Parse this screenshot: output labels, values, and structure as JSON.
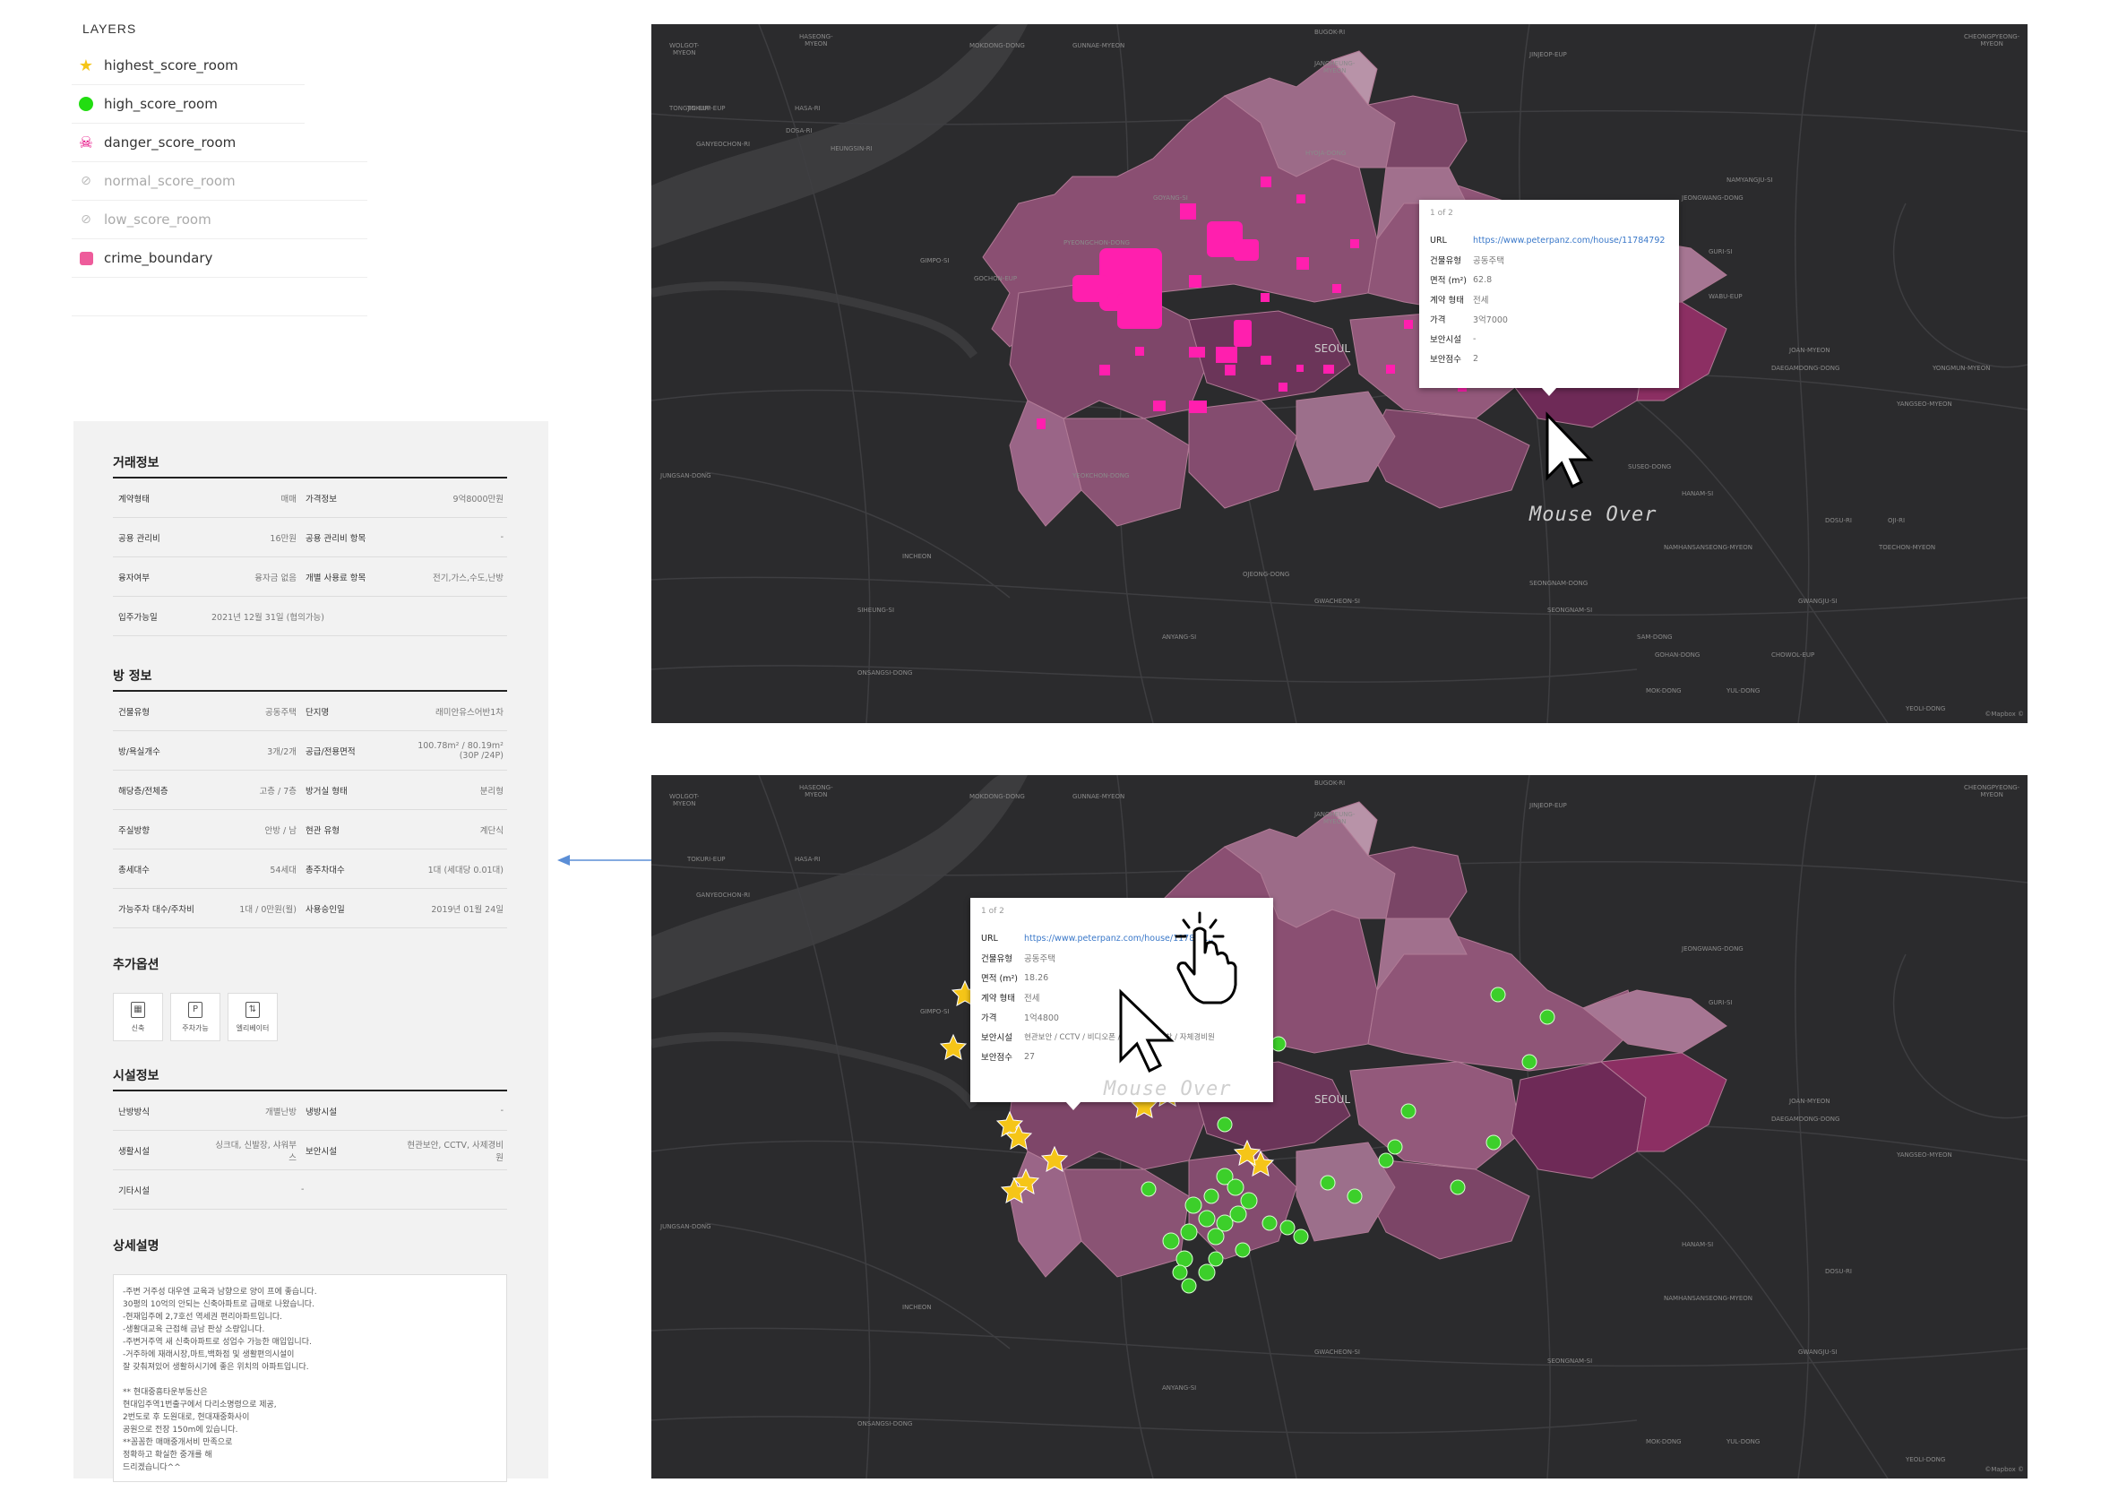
{
  "layers": {
    "title": "LAYERS",
    "items": [
      {
        "label": "highest_score_room",
        "icon": "star-icon",
        "color": "#f5c518",
        "visible": true
      },
      {
        "label": "high_score_room",
        "icon": "dot-icon",
        "color": "#22dd11",
        "visible": true
      },
      {
        "label": "danger_score_room",
        "icon": "skull-icon",
        "color": "#e6007e",
        "visible": true
      },
      {
        "label": "normal_score_room",
        "icon": "hidden-eye-icon",
        "color": "#aaaaaa",
        "visible": false
      },
      {
        "label": "low_score_room",
        "icon": "hidden-eye-icon",
        "color": "#aaaaaa",
        "visible": false
      },
      {
        "label": "crime_boundary",
        "icon": "square-icon",
        "color": "#ee5c9b",
        "visible": true
      }
    ]
  },
  "detail": {
    "sections": {
      "trade": {
        "title": "거래정보",
        "rows": [
          {
            "k1": "계약형태",
            "v1": "매매",
            "k2": "가격정보",
            "v2": "9억8000만원"
          },
          {
            "k1": "공용 관리비",
            "v1": "16만원",
            "k2": "공용 관리비 항목",
            "v2": "-"
          },
          {
            "k1": "융자여부",
            "v1": "융자금 없음",
            "k2": "개별 사용료 항목",
            "v2": "전기,가스,수도,난방"
          }
        ],
        "single": {
          "k": "입주가능일",
          "v": "2021년 12월 31일 (협의가능)"
        }
      },
      "room": {
        "title": "방 정보",
        "rows": [
          {
            "k1": "건물유형",
            "v1": "공동주택",
            "k2": "단지명",
            "v2": "래미안유스어반1차"
          },
          {
            "k1": "방/욕실개수",
            "v1": "3개/2개",
            "k2": "공급/전용면적",
            "v2": "100.78m² / 80.19m² (30P /24P)"
          },
          {
            "k1": "해당층/전체층",
            "v1": "고층 / 7층",
            "k2": "방거실 형태",
            "v2": "분리형"
          },
          {
            "k1": "주실방향",
            "v1": "안방 / 남",
            "k2": "현관 유형",
            "v2": "계단식"
          },
          {
            "k1": "총세대수",
            "v1": "54세대",
            "k2": "총주차대수",
            "v2": "1대 (세대당 0.01대)"
          },
          {
            "k1": "가능주차 대수/주차비",
            "v1": "1대 / 0만원(월)",
            "k2": "사용승인일",
            "v2": "2019년 01월 24일"
          }
        ]
      },
      "options": {
        "title": "추가옵션",
        "items": [
          {
            "label": "신축",
            "icon": "building-icon"
          },
          {
            "label": "주차가능",
            "icon": "parking-icon"
          },
          {
            "label": "엘리베이터",
            "icon": "elevator-icon"
          }
        ]
      },
      "facility": {
        "title": "시설정보",
        "rows": [
          {
            "k1": "난방방식",
            "v1": "개별난방",
            "k2": "냉방시설",
            "v2": "-"
          },
          {
            "k1": "생활시설",
            "v1": "싱크대, 신발장, 샤워부스",
            "k2": "보안시설",
            "v2": "현관보안, CCTV, 사제경비원"
          }
        ],
        "single": {
          "k": "기타시설",
          "v": "-"
        }
      },
      "description": {
        "title": "상세설명",
        "text": "-주변 거주성 대우엔 교육과 남향으로 양이 프에 좋습니다.\n30평의 10억의 안되는 신축아파트로 급매로 나왔습니다.\n-현재입주에 2,7호선 역세권 편리아파트입니다.\n-생활대교육 근접해 금남 판상 소량입니다.\n-주변거주역 새 신축아파트로 성업수 가능한 매입입니다.\n-거주하에 재래시장,마트,백화점 및 생활편의시설이\n잘 갖춰져있어 생활하시기에 좋은 위치의 아파트입니다.\n\n** 현대중흥타운부동산은\n현대입주역1번출구에서 다리소명령으로 제공,\n2번도로 후 도원대로, 현대재중화사이\n공원으로 전장 150m에 있습니다.\n**꼼꼼한 매매중개서비 만족으로\n정확하고 확실한 중개를 해\n드리겠습니다^^"
      }
    }
  },
  "map1": {
    "popup": {
      "page": "1 of 2",
      "rows": [
        {
          "k": "URL",
          "v": "https://www.peterpanz.com/house/11784792"
        },
        {
          "k": "건물유형",
          "v": "공동주택"
        },
        {
          "k": "면적 (m²)",
          "v": "62.8"
        },
        {
          "k": "계약 형태",
          "v": "전세"
        },
        {
          "k": "가격",
          "v": "3억7000"
        },
        {
          "k": "보안시설",
          "v": "-"
        },
        {
          "k": "보안점수",
          "v": "2"
        }
      ]
    },
    "caption": "Mouse Over",
    "seoul": "SEOUL",
    "attribution": "©Mapbox ©"
  },
  "map2": {
    "popup": {
      "page": "1 of 2",
      "rows": [
        {
          "k": "URL",
          "v": "https://www.peterpanz.com/house/117844..."
        },
        {
          "k": "건물유형",
          "v": "공동주택"
        },
        {
          "k": "면적 (m²)",
          "v": "18.26"
        },
        {
          "k": "계약 형태",
          "v": "전세"
        },
        {
          "k": "가격",
          "v": "1억4800"
        },
        {
          "k": "보안시설",
          "v": "현관보안 / CCTV / 비디오폰 / 카드키 / 방범창 / 자체경비원"
        },
        {
          "k": "보안점수",
          "v": "27"
        }
      ]
    },
    "caption": "Mouse Over",
    "seoul": "SEOUL",
    "attribution": "©Mapbox ©"
  },
  "place_labels": [
    "HASEONG-\nMYEON",
    "WOLGOT-\nMYEON",
    "TONGJIN-EUP",
    "MOKDONG-DONG",
    "GUNNAE-MYEON",
    "BUGOK-RI",
    "JANGHEUNG-\nMYEON",
    "JINJEOP-EUP",
    "CHEONGPYEONG-\nMYEON",
    "TOKURI-EUP",
    "HASA-RI",
    "GANYEOCHON-RI",
    "DOSA-RI",
    "HEUNGSIN-RI",
    "GIMPO-SI",
    "GOCHON-EUP",
    "PYEONGCHON-DONG",
    "GOYANG-SI",
    "HYOJA-DONG",
    "JEONGWANG-DONG",
    "GURI-SI",
    "WABU-EUP",
    "JOAN-MYEON",
    "NAMYANGJU-SI",
    "DAEGAMDONG-DONG",
    "YANGSEO-MYEON",
    "YONGMUN-MYEON",
    "INCHEON",
    "SIHEUNG-SI",
    "ANYANG-SI",
    "GWACHEON-SI",
    "SEONGNAM-SI",
    "HANAM-SI",
    "GWANGJU-SI",
    "ONSANGSI-DONG",
    "OJEONG-DONG",
    "SEONGNAM-DONG",
    "SAM-DONG",
    "YEOKCHON-DONG",
    "GOHAN-DONG",
    "MOK-DONG",
    "YUL-DONG",
    "CHOWOL-EUP",
    "YEOLI-DONG",
    "JUNGSAN-DONG",
    "NAMHANSANSEONG-MYEON",
    "DOSU-RI",
    "OJI-RI",
    "TOECHON-MYEON",
    "SUSEO-DONG"
  ]
}
